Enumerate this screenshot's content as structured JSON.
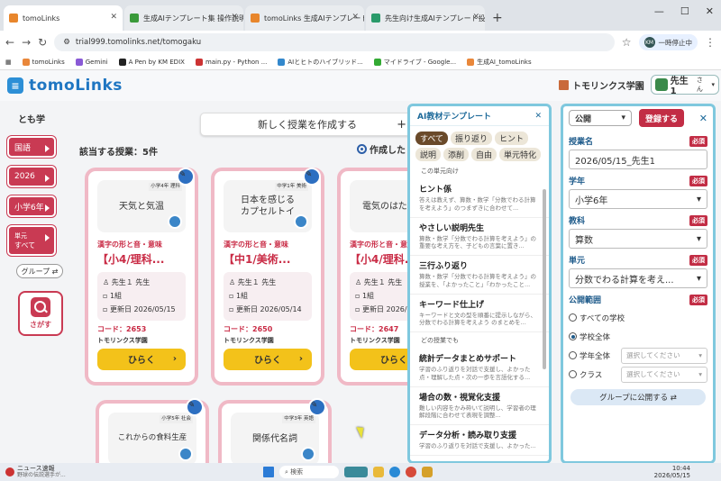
{
  "browser": {
    "tabs": [
      {
        "label": "tomoLinks",
        "active": true
      },
      {
        "label": "生成AIテンプレート集 操作説明"
      },
      {
        "label": "tomoLinks 生成AIテンプレート集"
      },
      {
        "label": "先生向け生成AIテンプレート投稿フォ"
      }
    ],
    "url": "trial999.tomolinks.net/tomogaku",
    "profile_initials": "KM",
    "profile_status": "一時停止中",
    "bookmarks": [
      "tomoLinks",
      "Gemini",
      "A Pen by KM EDIX",
      "main.py - Python ...",
      "AIとヒトのハイブリッド...",
      "マイドライブ - Google...",
      "生成AI_tomoLinks"
    ]
  },
  "app": {
    "logo": "tomoLinks",
    "school": "トモリンクス学園",
    "user": "先生1",
    "user_suffix": "さん"
  },
  "leftnav": {
    "title": "とも学",
    "filters": [
      {
        "label": "国語"
      },
      {
        "label": "2026"
      },
      {
        "label": "小学6年"
      },
      {
        "label": "単元",
        "value": "すべて"
      }
    ],
    "group_label": "グループ ⇄",
    "search_label": "さがす"
  },
  "main": {
    "new_lesson": "新しく授業を作成する",
    "count": "該当する授業：5件",
    "sort_label": "作成した",
    "cards": [
      {
        "thumb": "天気と気温",
        "tag": "小学4年 理科",
        "sub": "漢字の形と音・意味",
        "title": "【小4/理科...",
        "teacher": "先生１ 先生",
        "klass": "1組",
        "updated_label": "更新日",
        "updated": "2026/05/15",
        "code": "コード：2653",
        "school": "トモリンクス学園",
        "open": "ひらく"
      },
      {
        "thumb": "日本を感じる\nカプセルトイ",
        "tag": "中学1年 美術",
        "sub": "漢字の形と音・意味",
        "title": "【中1/美術...",
        "teacher": "先生１ 先生",
        "klass": "1組",
        "updated_label": "更新日",
        "updated": "2026/05/14",
        "code": "コード：2650",
        "school": "トモリンクス学園",
        "open": "ひらく"
      },
      {
        "thumb": "電気のはたら",
        "tag": "",
        "sub": "漢字の形と音・意味",
        "title": "【小4/理科...",
        "teacher": "先生１ 先生",
        "klass": "1組",
        "updated_label": "更新日",
        "updated": "2026/05/",
        "code": "コード：2647",
        "school": "トモリンクス学園",
        "open": "ひらく"
      },
      {
        "thumb": "これからの食料生産",
        "tag": "小学5年 社会"
      },
      {
        "thumb": "関係代名詞",
        "tag": "中学3年 英語"
      }
    ]
  },
  "templates": {
    "title": "AI教材テンプレート",
    "chips": [
      "すべて",
      "振り返り",
      "ヒント",
      "説明",
      "添削",
      "自由",
      "単元特化"
    ],
    "section_unit": "この単元向け",
    "section_other": "どの授業でも",
    "items_unit": [
      {
        "title": "ヒント係",
        "desc": "答えは教えず、算数・数学「分数でわる計算を考えよう」のつまずきに合わせて..."
      },
      {
        "title": "やさしい説明先生",
        "desc": "算数・数学「分数でわる計算を考えよう」の重要な考え方を、子どもの言葉に置き..."
      },
      {
        "title": "三行ふり返り",
        "desc": "算数・数学「分数でわる計算を考えよう」の授業を、「よかったこと」「わかったこと..."
      },
      {
        "title": "キーワード仕上げ",
        "desc": "キーワードと文の型を順番に提示しながら、分数でわる計算を考えよう のまとめを..."
      }
    ],
    "items_other": [
      {
        "title": "統計データまとめサポート",
        "desc": "学習のふり返りを対話で支援し、よかった点・理解した点・次の一歩を言語化する..."
      },
      {
        "title": "場合の数・視覚化支援",
        "desc": "難しい内容をかみ砕いて説明し、学習者の理解段階に合わせて表現を調整..."
      },
      {
        "title": "データ分析・読み取り支援",
        "desc": "学習のふり返りを対話で支援し、よかった..."
      }
    ]
  },
  "form": {
    "visibility": "公開",
    "register": "登録する",
    "required": "必須",
    "lesson_name_label": "授業名",
    "lesson_name": "2026/05/15_先生1",
    "grade_label": "学年",
    "grade": "小学6年",
    "subject_label": "教科",
    "subject": "算数",
    "unit_label": "単元",
    "unit": "分数でわる計算を考え...",
    "scope_label": "公開範囲",
    "scope_options": [
      {
        "label": "すべての学校",
        "checked": false,
        "select": ""
      },
      {
        "label": "学校全体",
        "checked": true,
        "select": ""
      },
      {
        "label": "学年全体",
        "checked": false,
        "select": "選択してください"
      },
      {
        "label": "クラス",
        "checked": false,
        "select": "選択してください"
      }
    ],
    "group_publish": "グループに公開する ⇄"
  },
  "taskbar": {
    "news_title": "ニュース速報",
    "news_sub": "野球の伝説選手が...",
    "search": "検索",
    "time": "10:44",
    "date": "2026/05/15"
  }
}
